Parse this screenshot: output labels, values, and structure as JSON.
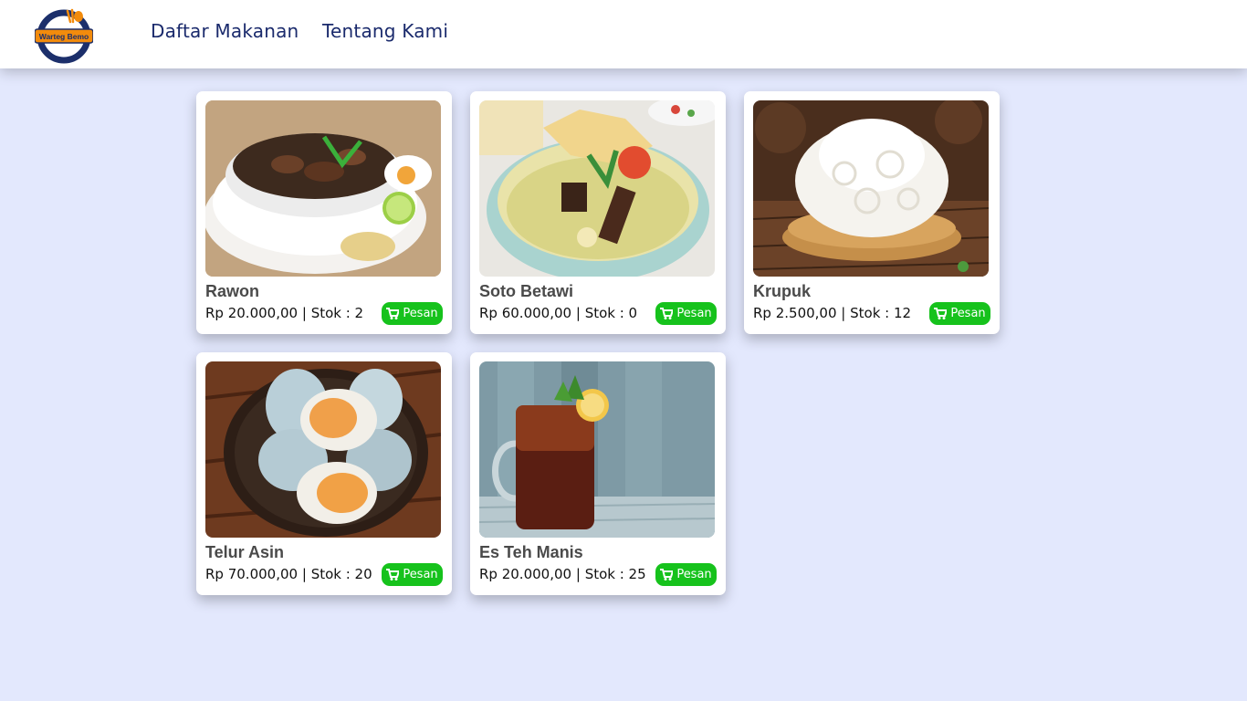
{
  "brand": {
    "logo_text": "Warteg Bemo"
  },
  "nav": {
    "items": [
      {
        "label": "Daftar Makanan"
      },
      {
        "label": "Tentang Kami"
      }
    ]
  },
  "colors": {
    "background": "#e3e8fd",
    "accent_button": "#16c21c",
    "nav_text": "#1a2a6c"
  },
  "products": [
    {
      "name": "Rawon",
      "price": "Rp 20.000,00",
      "stock": "Stok : 2",
      "separator": "|",
      "button_label": "Pesan",
      "button_icon": "cart-icon"
    },
    {
      "name": "Soto Betawi",
      "price": "Rp 60.000,00",
      "stock": "Stok : 0",
      "separator": "|",
      "button_label": "Pesan",
      "button_icon": "cart-icon"
    },
    {
      "name": "Krupuk",
      "price": "Rp 2.500,00",
      "stock": "Stok : 12",
      "separator": "|",
      "button_label": "Pesan",
      "button_icon": "cart-icon"
    },
    {
      "name": "Telur Asin",
      "price": "Rp 70.000,00",
      "stock": "Stok : 20",
      "separator": "|",
      "button_label": "Pesan",
      "button_icon": "cart-icon"
    },
    {
      "name": "Es Teh Manis",
      "price": "Rp 20.000,00",
      "stock": "Stok : 25",
      "separator": "|",
      "button_label": "Pesan",
      "button_icon": "cart-icon"
    }
  ]
}
